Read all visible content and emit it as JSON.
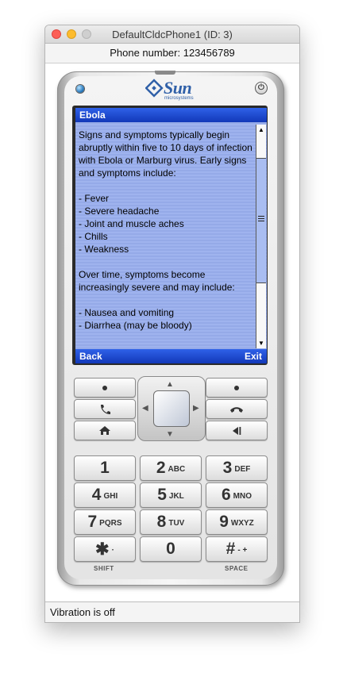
{
  "window": {
    "title": "DefaultCldcPhone1 (ID: 3)"
  },
  "phone_number_label": "Phone number: 123456789",
  "brand": {
    "logo_text": "Sun",
    "logo_subtext": "microsystems"
  },
  "screen": {
    "title": "Ebola",
    "body": "Signs and symptoms typically begin abruptly within five to 10 days of infection with Ebola or Marburg virus. Early signs and symptoms include:\n\n- Fever\n- Severe headache\n- Joint and muscle aches\n- Chills\n- Weakness\n\nOver time, symptoms become increasingly severe and may include:\n\n- Nausea and vomiting\n- Diarrhea (may be bloody)",
    "soft_left": "Back",
    "soft_right": "Exit",
    "scroll_position": 0.3
  },
  "keypad": {
    "keys": [
      {
        "num": "1",
        "sub": ""
      },
      {
        "num": "2",
        "sub": "ABC"
      },
      {
        "num": "3",
        "sub": "DEF"
      },
      {
        "num": "4",
        "sub": "GHI"
      },
      {
        "num": "5",
        "sub": "JKL"
      },
      {
        "num": "6",
        "sub": "MNO"
      },
      {
        "num": "7",
        "sub": "PQRS"
      },
      {
        "num": "8",
        "sub": "TUV"
      },
      {
        "num": "9",
        "sub": "WXYZ"
      },
      {
        "num": "✱",
        "sub": "·"
      },
      {
        "num": "0",
        "sub": ""
      },
      {
        "num": "#",
        "sub": "- +"
      }
    ],
    "shift_label": "SHIFT",
    "space_label": "SPACE"
  },
  "status": {
    "text": "Vibration is off"
  },
  "colors": {
    "screen_bg": "#9fb3ee",
    "title_bar": "#1f4fd6",
    "sun_blue": "#3060a8"
  }
}
